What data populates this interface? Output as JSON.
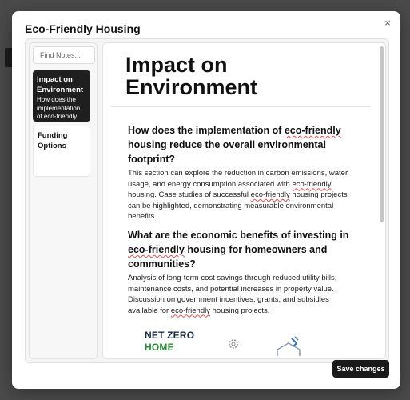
{
  "dialog": {
    "title": "Eco-Friendly Housing",
    "close_label": "×",
    "save_label": "Save changes"
  },
  "sidebar": {
    "search_placeholder": "Find Notes...",
    "notes": [
      {
        "title": "Impact on Environment",
        "snippet": "How does the implementation of eco-friendly",
        "active": true
      },
      {
        "title": "Funding Options",
        "snippet": "",
        "active": false
      }
    ]
  },
  "editor": {
    "title": "Impact on Environment",
    "sections": [
      {
        "question_pre": "How does the implementation of ",
        "question_mark": "eco-friendly",
        "question_post": " housing reduce the overall environmental footprint?",
        "answer_1": "This section can explore the reduction in carbon emissions, water usage, and energy consumption associated with ",
        "answer_mark_1": "eco-friendly",
        "answer_2": " housing. Case studies of successful ",
        "answer_mark_2": "eco-friendly",
        "answer_3": " housing projects can be highlighted, demonstrating measurable environmental benefits."
      },
      {
        "question_pre": "What are the economic benefits of investing in ",
        "question_mark": "eco-friendly",
        "question_post": " housing for homeowners and communities?",
        "answer_1": "Analysis of long-term cost savings through reduced utility bills, maintenance costs, and potential increases in property value. Discussion on government incentives, grants, and subsidies available for ",
        "answer_mark_1": "eco-friendly",
        "answer_2": " housing projects."
      }
    ],
    "image_text": {
      "line1": "NET ZERO",
      "line2": "HOME"
    }
  },
  "colors": {
    "accent": "#1a1a1a",
    "netzero_blue": "#1b2a44",
    "netzero_green": "#2a8a3a"
  }
}
